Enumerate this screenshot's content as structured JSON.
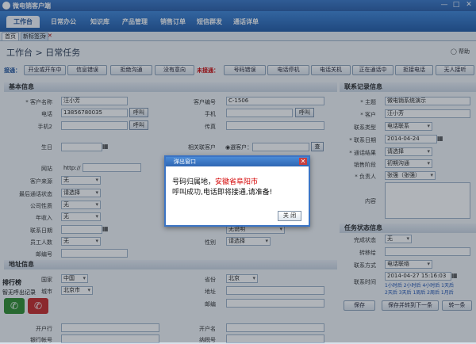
{
  "app": {
    "title": "微电销客户端"
  },
  "window_controls": [
    "—",
    "□",
    "✕"
  ],
  "menu": [
    "工作台",
    "日常办公",
    "知识库",
    "产品管理",
    "销售订单",
    "短信群发",
    "通话详单"
  ],
  "tabs": [
    "首页",
    "新标签页"
  ],
  "breadcrumb": "工作台 > 日常任务",
  "help": "帮助",
  "toolbar": {
    "connected_label": "接通：",
    "connected_buttons": [
      "开业或开车中",
      "信息错误",
      "拒绝沟通",
      "没有意向"
    ],
    "unconnected_label": "未接通：",
    "unconnected_buttons": [
      "号码错误",
      "电话停机",
      "电话关机",
      "正在通话中",
      "拒接电话",
      "无人接听"
    ]
  },
  "basic": {
    "section": "基本信息",
    "name_label": "* 客户名称",
    "name_value": "汪小芳",
    "phone_label": "电话",
    "phone_value": "13856780035",
    "call_label": "呼叫",
    "mobile2_label": "手机2",
    "call2_label": "呼叫",
    "birthday_label": "生日",
    "website_label": "网站",
    "website_value": "http://",
    "source_label": "客户来源",
    "source_value": "无",
    "last_status_label": "最后通话状态",
    "last_status_value": "请选择",
    "company_label": "公司性质",
    "company_value": "无",
    "income_label": "年收入",
    "income_value": "无",
    "contact_date_label": "联系日期",
    "staff_label": "员工人数",
    "staff_value": "无",
    "zip_label": "邮编号",
    "code_label": "客户编号",
    "code_value": "C-1506",
    "mobile_label": "手机",
    "call3_label": "呼叫",
    "fax_label": "传真",
    "related_label": "相关联客户",
    "related_radio": "◉選客户：",
    "related_btn": "查",
    "gender_label": "性别",
    "gender_value": "请选择",
    "source2_value": "无说明"
  },
  "address": {
    "section": "地址信息",
    "country_label": "国家",
    "country_value": "中国",
    "province_label": "省份",
    "province_value": "北京",
    "city_label": "城市",
    "city_value": "北京市",
    "address_label": "地址",
    "postcode_label": "邮编"
  },
  "bank": {
    "bank_label": "开户行",
    "tax_label": "开户名",
    "account_label": "银行帐号",
    "taxno_label": "纳税号"
  },
  "ranking": {
    "title": "排行榜",
    "no_calls": "智无呼出记录"
  },
  "contact_record": {
    "section": "联系记录信息",
    "subject_label": "* 主题",
    "subject_value": "微电销系统演示",
    "customer_label": "* 客户",
    "customer_value": "汪小芳",
    "type_label": "联系类型",
    "type_value": "电话联系",
    "date_label": "* 联系日期",
    "date_value": "2014-04-24",
    "result_label": "* 通话结果",
    "result_value": "请选择",
    "stage_label": "销售阶段",
    "stage_value": "初期沟通",
    "owner_label": "* 负责人",
    "owner_value": "张强（张强）",
    "content_label": "内容"
  },
  "task_status": {
    "section": "任务状态信息",
    "done_label": "完成状态",
    "done_value": "无",
    "transfer_label": "转移给",
    "method_label": "联系方式",
    "method_value": "电话联络",
    "time_label": "联系时间",
    "time_value": "2014-04-27 15:16:03",
    "quick_times_1": "1小时后 2小时后 4小时后 1天后",
    "quick_times_2": "2天后 3天后 1周后 2周后 1月后"
  },
  "actions": {
    "save": "保存",
    "save_next": "保存并转到下一条",
    "next": "转一条"
  },
  "dialog": {
    "title": "弹出窗口",
    "line1_prefix": "号码归属地，",
    "line1_city": "安徽省阜阳市",
    "line2": "呼叫成功,电话即将接通,请准备!",
    "close": "关 闭"
  }
}
